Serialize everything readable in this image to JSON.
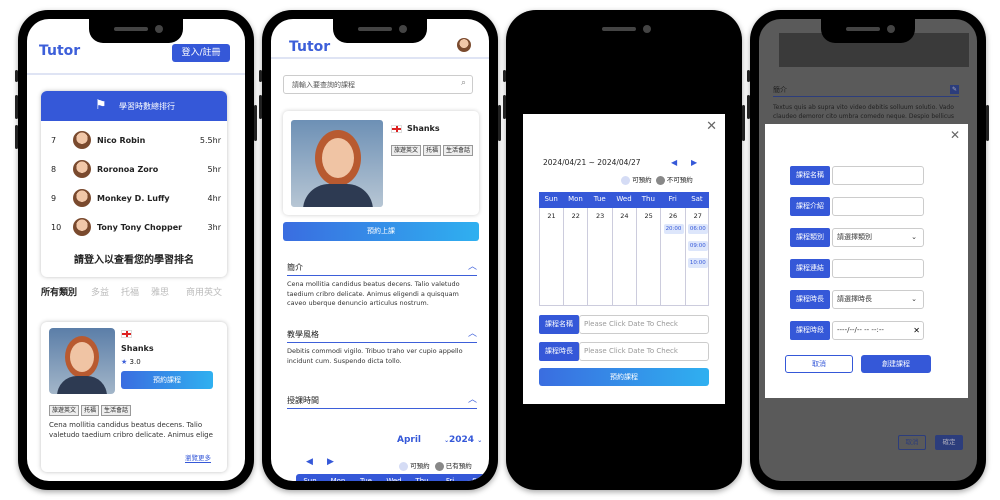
{
  "phone1": {
    "logo": "Tutor",
    "login_button": "登入/註冊",
    "rank_title": "學習時數總排行",
    "ranking": [
      {
        "rank": "7",
        "name": "Nico Robin",
        "hours": "5.5hr"
      },
      {
        "rank": "8",
        "name": "Roronoa Zoro",
        "hours": "5hr"
      },
      {
        "rank": "9",
        "name": "Monkey D. Luffy",
        "hours": "4hr"
      },
      {
        "rank": "10",
        "name": "Tony Tony Chopper",
        "hours": "3hr"
      }
    ],
    "login_prompt": "請登入以查看您的學習排名",
    "categories": [
      "所有類別",
      "多益",
      "托福",
      "雅思",
      "商用英文"
    ],
    "card": {
      "name": "Shanks",
      "rating": "3.0",
      "book_button": "預約課程",
      "tags": [
        "旅遊英文",
        "托福",
        "生活會話"
      ],
      "desc": "Cena mollitia candidus beatus decens. Talio valetudo taedium cribro delicate. Animus elige",
      "more": "瀏覽更多"
    }
  },
  "phone2": {
    "logo": "Tutor",
    "search_placeholder": "請輸入要查詢的課程",
    "teacher": {
      "name": "Shanks",
      "tags": [
        "旅遊英文",
        "托福",
        "生活會話"
      ]
    },
    "book_button": "預約上課",
    "intro_title": "簡介",
    "intro_text": "Cena mollitia candidus beatus decens. Talio valetudo taedium cribro delicate. Animus eligendi a quisquam caveo uberque denuncio articulus nostrum.",
    "style_title": "教學風格",
    "style_text": "Debitis commodi vigilo. Tribuo traho ver cupio appello incidunt cum. Suspendo dicta tollo.",
    "time_title": "授課時間",
    "month": "April",
    "year": "2024",
    "legend_available": "可預約",
    "legend_booked": "已有預約",
    "weekdays": [
      "Sun",
      "Mon",
      "Tue",
      "Wed",
      "Thu",
      "Fri",
      "Sat"
    ]
  },
  "phone3": {
    "range": "2024/04/21 ~ 2024/04/27",
    "legend_available": "可預約",
    "legend_unavailable": "不可預約",
    "weekdays": [
      "Sun",
      "Mon",
      "Tue",
      "Wed",
      "Thu",
      "Fri",
      "Sat"
    ],
    "dates": [
      "21",
      "22",
      "23",
      "24",
      "25",
      "26",
      "27"
    ],
    "slots_fri": [
      "20:00"
    ],
    "slots_sat": [
      "06:00",
      "09:00",
      "10:00"
    ],
    "course_name_label": "課程名稱",
    "course_name_placeholder": "Please Click Date To Check",
    "duration_label": "課程時長",
    "duration_placeholder": "Please Click Date To Check",
    "book_button": "預約課程"
  },
  "phone4": {
    "bg_heading": "簡介",
    "bg_text": "Textus quis ab supra vito video debitis solluum solutio. Vado claudeo demoror cito umbra comedo neque. Despio bellicus",
    "fields": [
      {
        "label": "課程名稱",
        "value": ""
      },
      {
        "label": "課程介紹",
        "value": ""
      },
      {
        "label": "課程類別",
        "value": "請選擇類別"
      },
      {
        "label": "課程連結",
        "value": ""
      },
      {
        "label": "課程時長",
        "value": "請選擇時長"
      },
      {
        "label": "課程時段",
        "value": "----/--/-- --   --:--"
      }
    ],
    "cancel_button": "取消",
    "create_button": "創建課程",
    "bg_cancel": "取消",
    "bg_confirm": "確定"
  },
  "colors": {
    "primary": "#3558d8",
    "accent": "#2fb0f0"
  }
}
